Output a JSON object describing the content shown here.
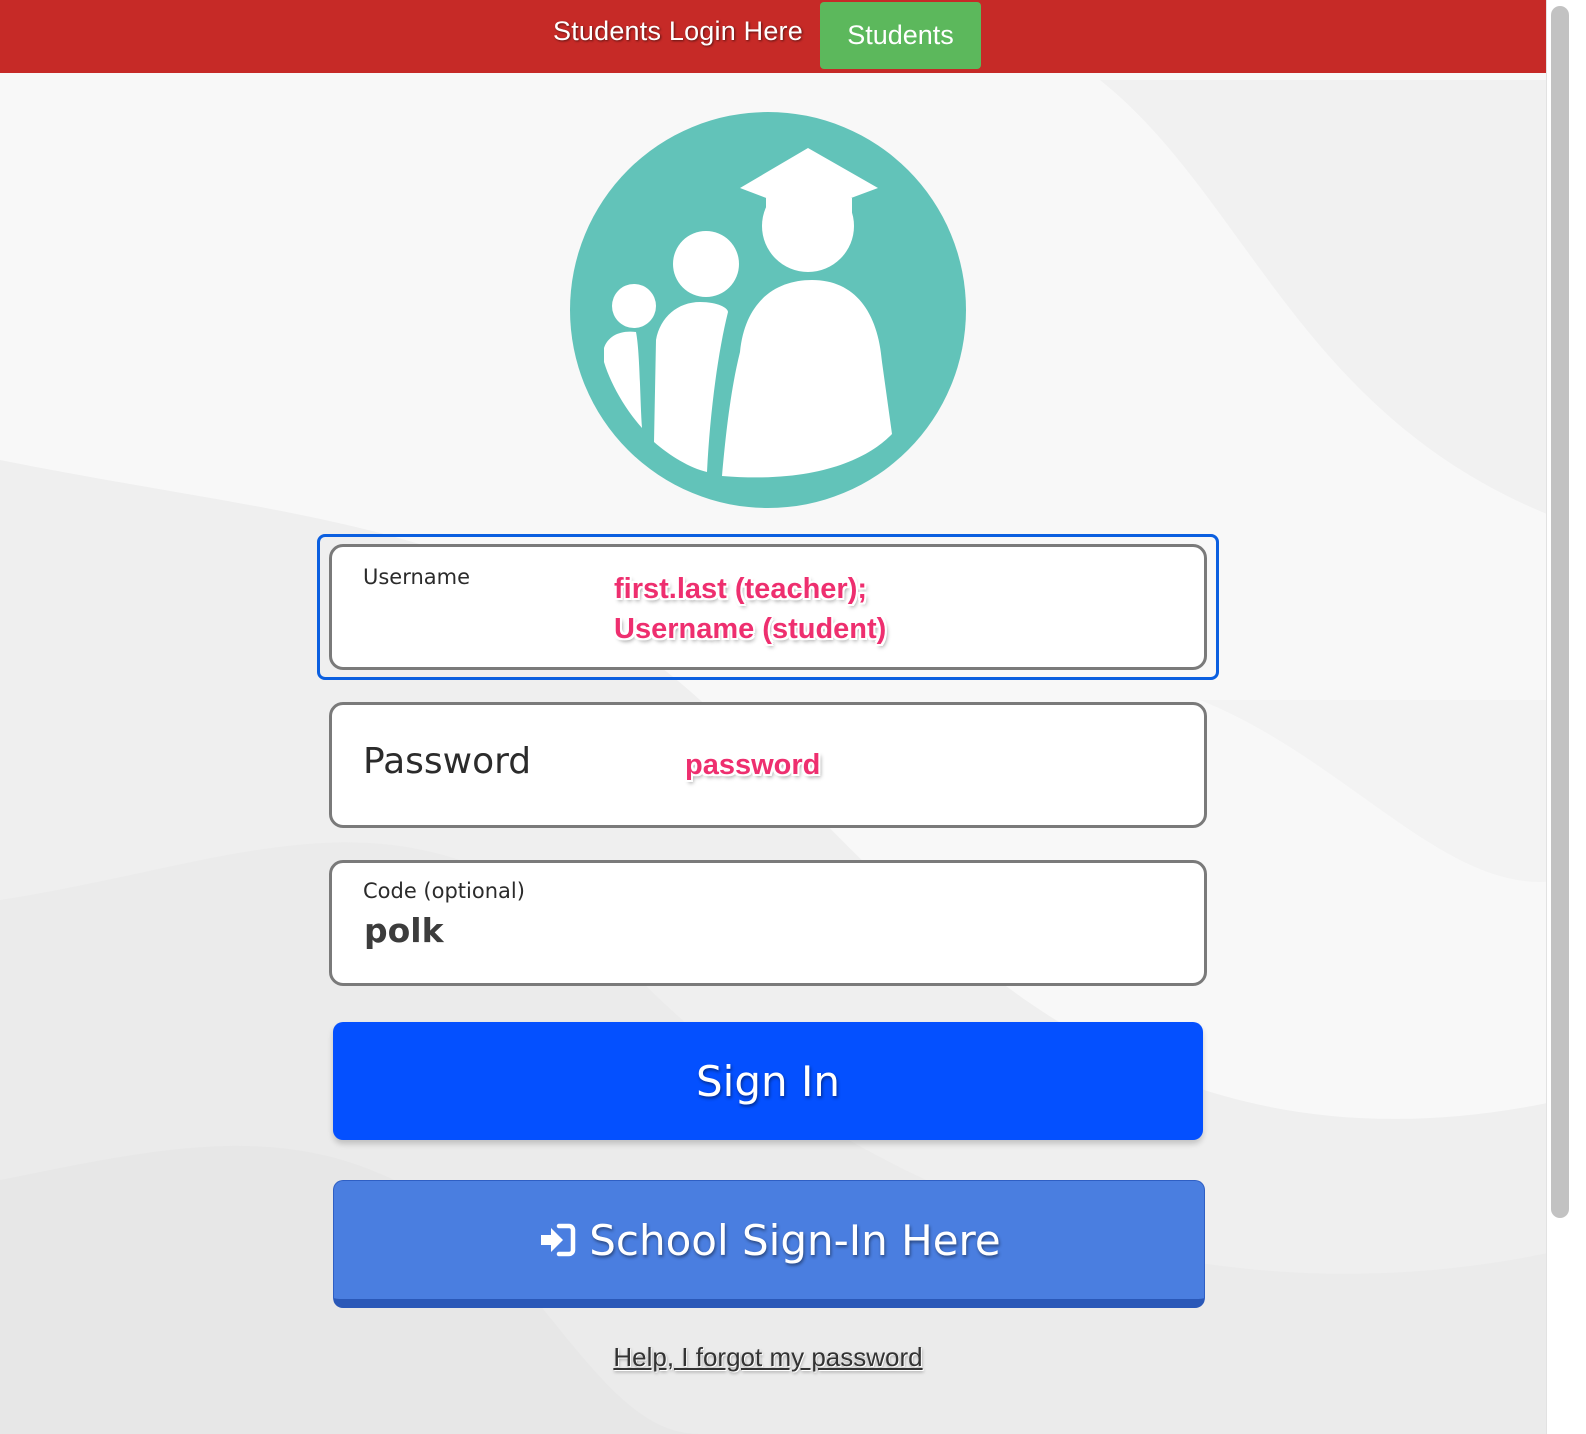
{
  "topbar": {
    "label": "Students Login Here",
    "button_label": "Students",
    "bg_color": "#c62a27",
    "button_color": "#5cb85c"
  },
  "logo": {
    "icon": "graduation-family-icon",
    "color": "#62c3b9"
  },
  "form": {
    "username": {
      "label": "Username",
      "annotation_line1": "first.last (teacher);",
      "annotation_line2": "Username (student)"
    },
    "password": {
      "label": "Password",
      "annotation": "password"
    },
    "code": {
      "label": "Code (optional)",
      "value": "polk"
    }
  },
  "actions": {
    "signin_label": "Sign In",
    "school_signin_label": "School Sign-In Here",
    "school_signin_icon": "sign-in-icon",
    "forgot_password_label": "Help, I forgot my password"
  },
  "colors": {
    "primary": "#0450ff",
    "secondary": "#4a7ee0",
    "annotation": "#ee2f6f"
  }
}
